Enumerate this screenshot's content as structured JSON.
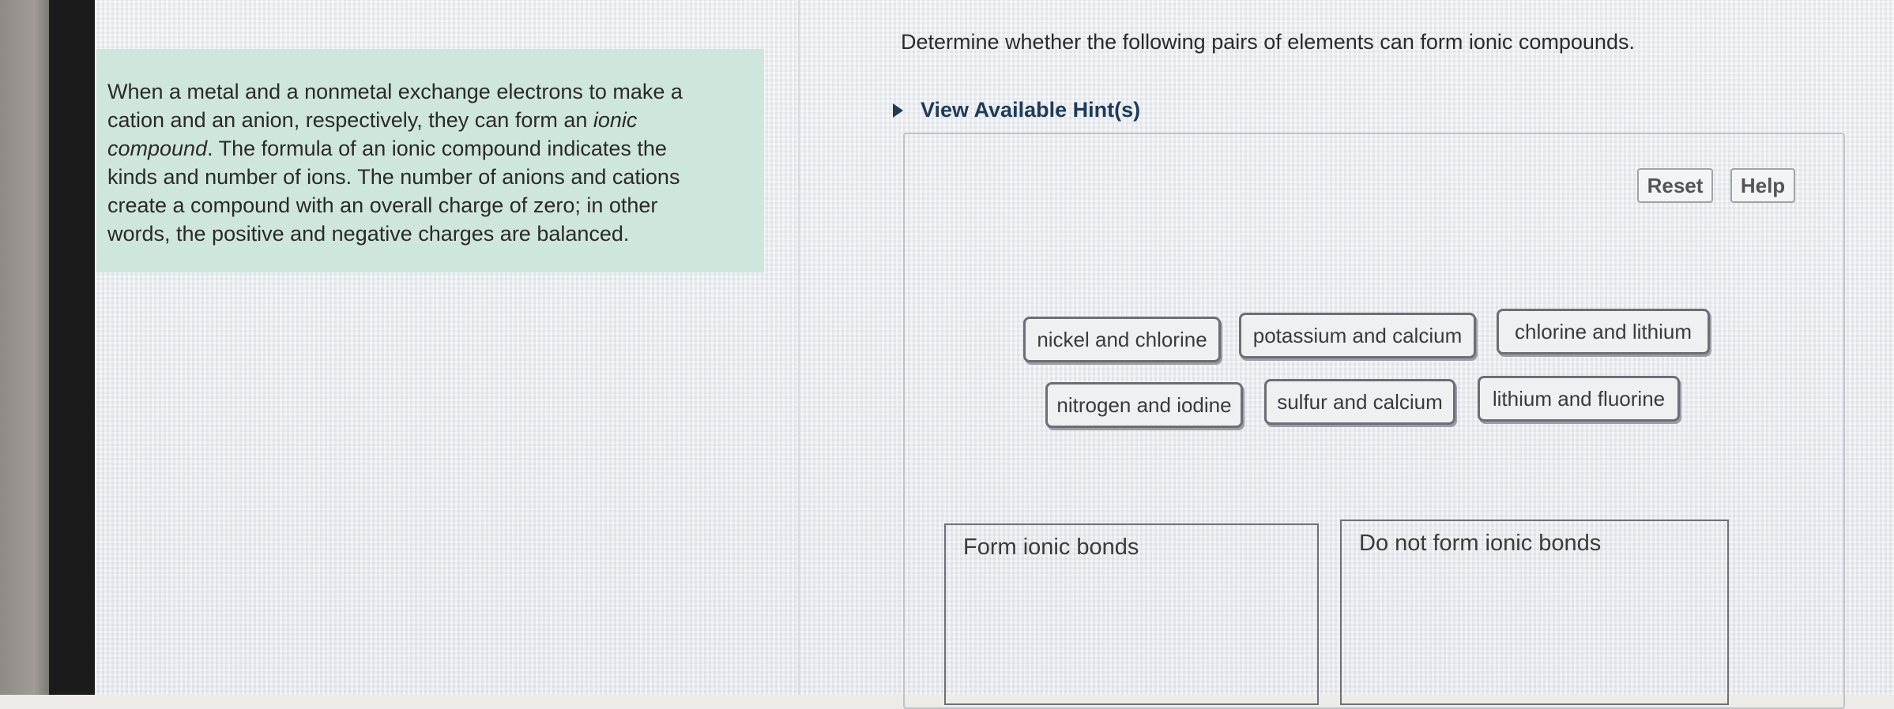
{
  "intro": {
    "p1": "When a metal and a nonmetal exchange electrons to make a",
    "p2a": "cation and an anion, respectively, they can form an ",
    "p2b": "ionic",
    "p3a": "compound",
    "p3b": ". The formula of an ionic compound indicates the",
    "p4": "kinds and number of ions. The number of anions and cations",
    "p5": "create a compound with an overall charge of zero; in other",
    "p6": "words, the positive and negative charges are balanced."
  },
  "question": "Determine whether the following pairs of elements can form ionic compounds.",
  "hint_label": "View Available Hint(s)",
  "buttons": {
    "reset": "Reset",
    "help": "Help"
  },
  "chips": [
    "nickel and chlorine",
    "potassium and calcium",
    "chlorine and lithium",
    "nitrogen and iodine",
    "sulfur and calcium",
    "lithium and fluorine"
  ],
  "targets": {
    "form": "Form ionic bonds",
    "not_form": "Do not form ionic bonds"
  }
}
